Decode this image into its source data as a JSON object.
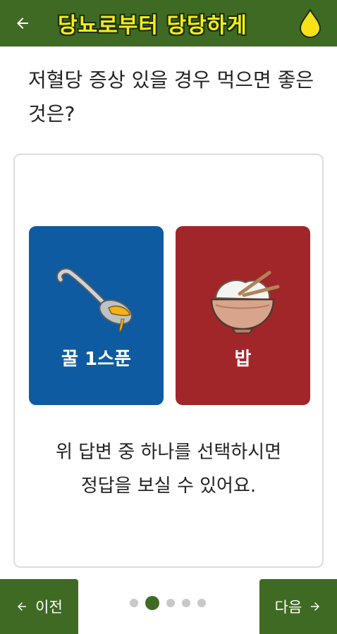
{
  "header": {
    "title": "당뇨로부터 당당하게",
    "back_icon": "arrow-left-icon",
    "drop_icon": "drop-icon",
    "title_color": "#f4ec1c",
    "bar_color": "#3f6a24"
  },
  "question": {
    "text": "저혈당 증상 있을 경우 먹으면 좋은것은?"
  },
  "options": [
    {
      "label": "꿀 1스푼",
      "color": "#0e5ba1",
      "icon": "honey-spoon-icon"
    },
    {
      "label": "밥",
      "color": "#a1262a",
      "icon": "rice-bowl-icon"
    }
  ],
  "hint": {
    "line1": "위 답변 중 하나를 선택하시면",
    "line2": "정답을 보실 수 있어요."
  },
  "nav": {
    "prev_label": "이전",
    "next_label": "다음"
  },
  "pager": {
    "total_visible": 5,
    "current_index": 1
  }
}
